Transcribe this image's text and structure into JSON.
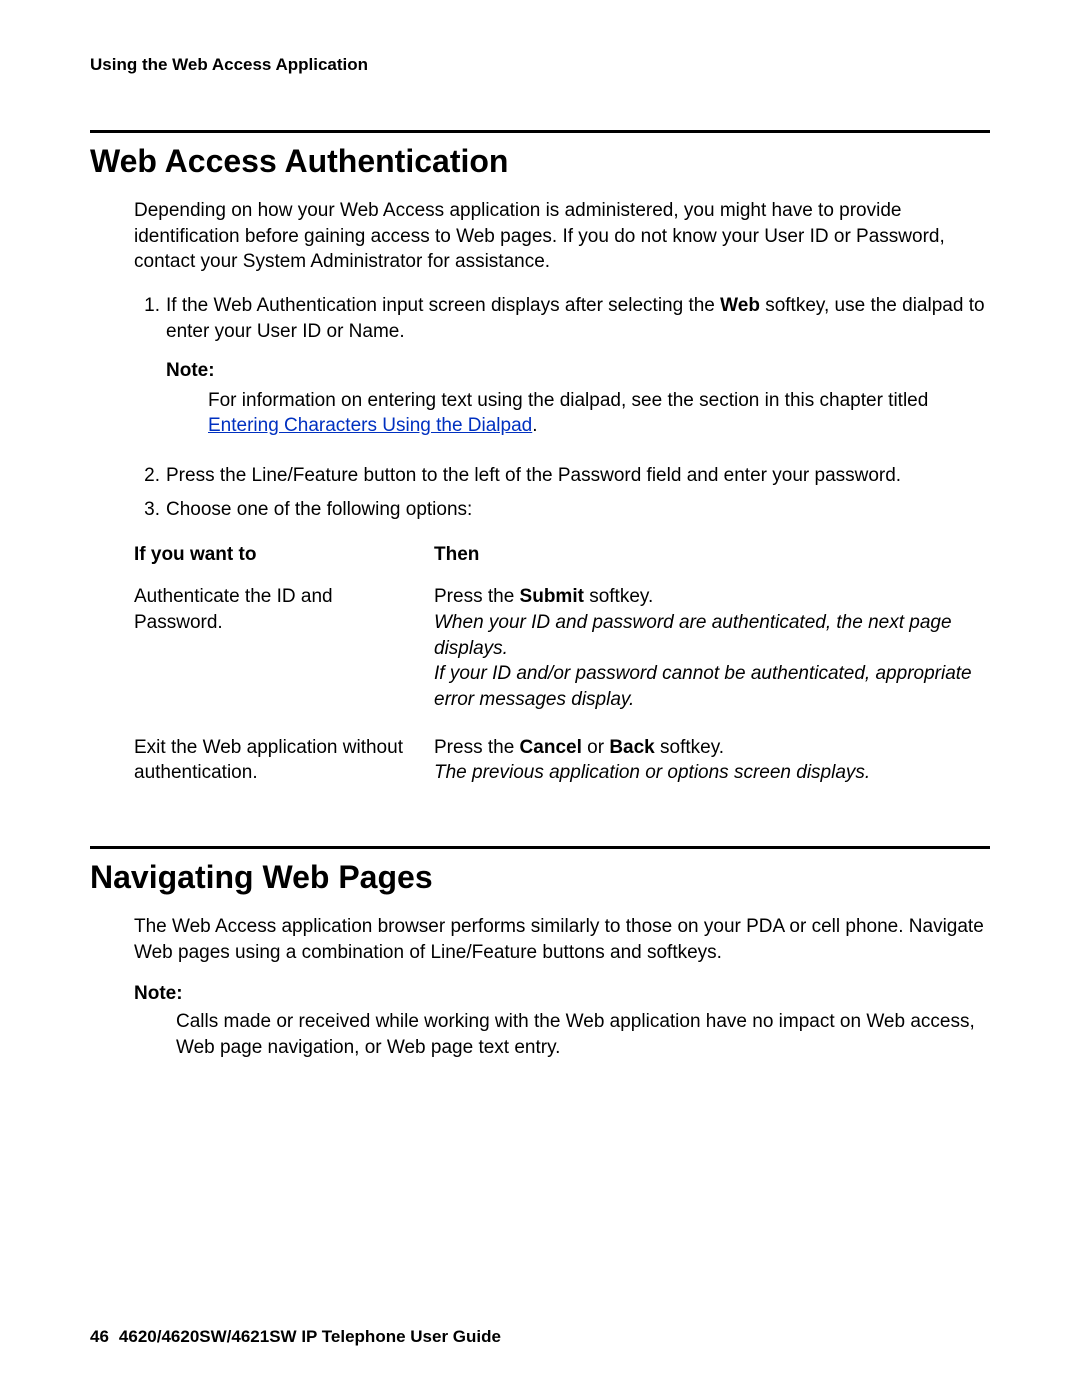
{
  "header": {
    "running_head": "Using the Web Access Application"
  },
  "sec1": {
    "title": "Web Access Authentication",
    "intro": "Depending on how your Web Access application is administered, you might have to provide identification before gaining access to Web pages. If you do not know your User ID or Password, contact your System Administrator for assistance.",
    "step1_marker": "1.",
    "step1_pre": "If the Web Authentication input screen displays after selecting the ",
    "step1_bold": "Web",
    "step1_post": " softkey, use the dialpad to enter your User ID or Name.",
    "note1_label": "Note:",
    "note1_pre": "For information on entering text using the dialpad, see the section in this chapter titled ",
    "note1_link": "Entering Characters Using the Dialpad",
    "note1_post": ".",
    "step2_marker": "2.",
    "step2": "Press the Line/Feature button to the left of the Password field and enter your password.",
    "step3_marker": "3.",
    "step3": "Choose one of the following options:",
    "table": {
      "head_if": "If you want to",
      "head_then": "Then",
      "r1_if": "Authenticate the ID and Password.",
      "r1_then_pre": "Press the ",
      "r1_then_bold": "Submit",
      "r1_then_post": " softkey.",
      "r1_italic1": "When your ID and password are authenticated, the next page displays.",
      "r1_italic2": "If your ID and/or password cannot be authenticated, appropriate error messages display.",
      "r2_if": "Exit the Web application without authentication.",
      "r2_then_pre": "Press the ",
      "r2_then_b1": "Cancel",
      "r2_then_mid": " or ",
      "r2_then_b2": "Back",
      "r2_then_post": " softkey.",
      "r2_italic": "The previous application or options screen displays."
    }
  },
  "sec2": {
    "title": "Navigating Web Pages",
    "intro": "The Web Access application browser performs similarly to those on your PDA or cell phone. Navigate Web pages using a combination of Line/Feature buttons and softkeys.",
    "note_label": "Note:",
    "note_body": "Calls made or received while working with the Web application have no impact on Web access, Web page navigation, or Web page text entry."
  },
  "footer": {
    "page_number": "46",
    "guide": "4620/4620SW/4621SW IP Telephone User Guide"
  }
}
